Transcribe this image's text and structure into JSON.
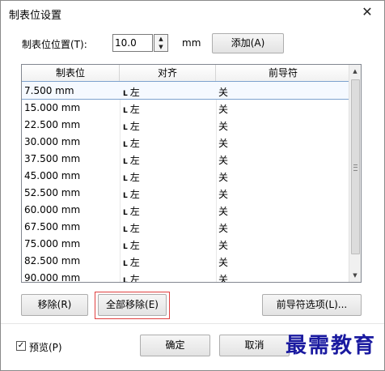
{
  "window": {
    "title": "制表位设置",
    "close_glyph": "✕"
  },
  "position": {
    "label": "制表位位置(T):",
    "value": "10.0",
    "unit": "mm",
    "add_button": "添加(A)"
  },
  "table": {
    "headers": [
      "制表位",
      "对齐",
      "前导符"
    ],
    "rows": [
      {
        "pos": "7.500 mm",
        "align": "左",
        "leader": "关"
      },
      {
        "pos": "15.000 mm",
        "align": "左",
        "leader": "关"
      },
      {
        "pos": "22.500 mm",
        "align": "左",
        "leader": "关"
      },
      {
        "pos": "30.000 mm",
        "align": "左",
        "leader": "关"
      },
      {
        "pos": "37.500 mm",
        "align": "左",
        "leader": "关"
      },
      {
        "pos": "45.000 mm",
        "align": "左",
        "leader": "关"
      },
      {
        "pos": "52.500 mm",
        "align": "左",
        "leader": "关"
      },
      {
        "pos": "60.000 mm",
        "align": "左",
        "leader": "关"
      },
      {
        "pos": "67.500 mm",
        "align": "左",
        "leader": "关"
      },
      {
        "pos": "75.000 mm",
        "align": "左",
        "leader": "关"
      },
      {
        "pos": "82.500 mm",
        "align": "左",
        "leader": "关"
      },
      {
        "pos": "90.000 mm",
        "align": "左",
        "leader": "关"
      }
    ]
  },
  "actions": {
    "remove": "移除(R)",
    "remove_all": "全部移除(E)",
    "leader_options": "前导符选项(L)..."
  },
  "footer": {
    "preview_label": "预览(P)",
    "preview_checked": true,
    "ok": "确定",
    "cancel": "取消"
  },
  "watermark": "最需教育",
  "colors": {
    "highlight_border": "#e04040",
    "watermark": "#1a1aa0"
  }
}
